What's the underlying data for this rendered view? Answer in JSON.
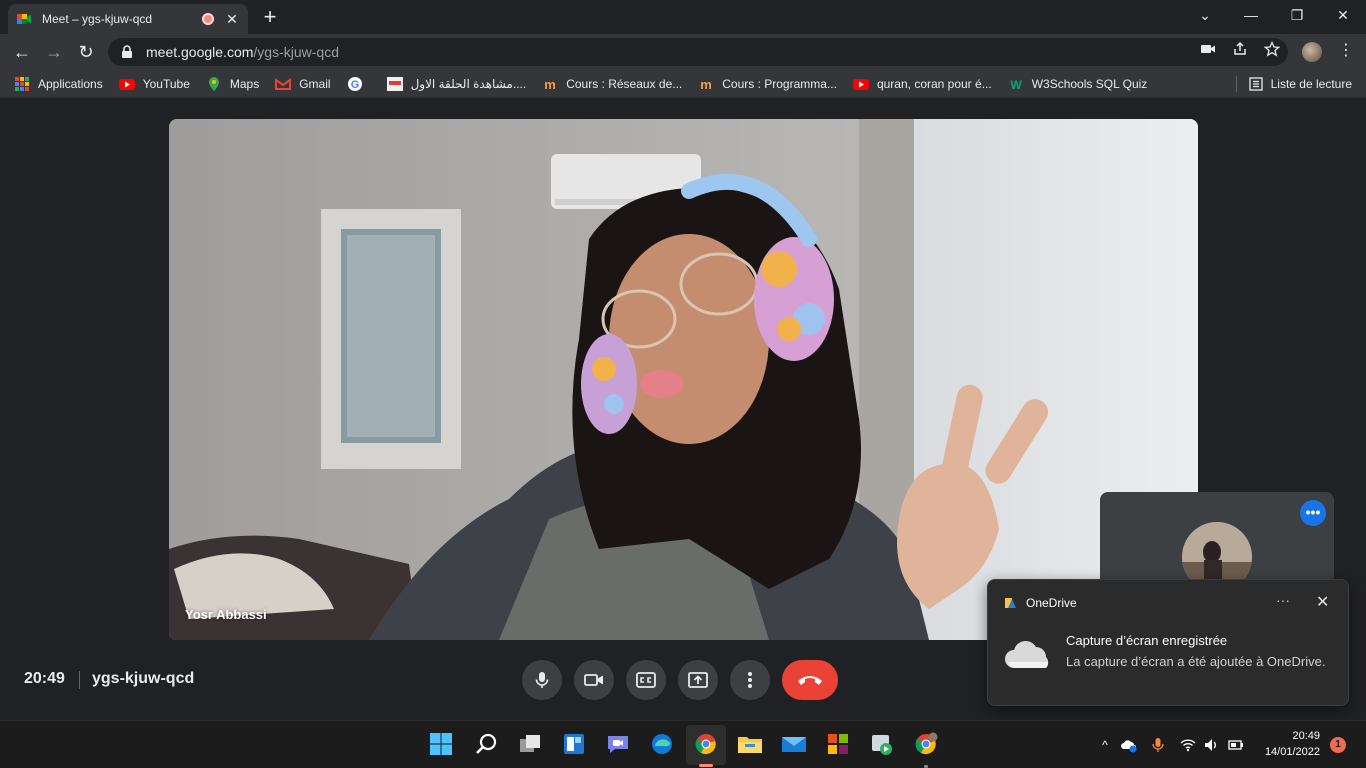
{
  "browser": {
    "tab": {
      "title": "Meet – ygs-kjuw-qcd",
      "close_glyph": "✕"
    },
    "new_tab_glyph": "+",
    "window_controls": {
      "minimize": "—",
      "restore": "❐",
      "close": "✕",
      "tablist": "⌄"
    },
    "nav": {
      "back": "←",
      "forward": "→",
      "reload": "↻"
    },
    "url": {
      "host": "meet.google.com",
      "path": "/ygs-kjuw-qcd"
    },
    "menu_glyph": "⋮",
    "bookmarks": [
      {
        "label": "Applications",
        "icon": "apps-grid-icon"
      },
      {
        "label": "YouTube",
        "icon": "youtube-icon"
      },
      {
        "label": "Maps",
        "icon": "maps-pin-icon"
      },
      {
        "label": "Gmail",
        "icon": "gmail-icon"
      },
      {
        "label": "",
        "icon": "google-icon"
      },
      {
        "label": "مشاهدة الحلقة الاول....",
        "icon": "site-thumb-icon"
      },
      {
        "label": "Cours : Réseaux de...",
        "icon": "openclassrooms-icon"
      },
      {
        "label": "Cours : Programma...",
        "icon": "openclassrooms-icon"
      },
      {
        "label": "quran, coran pour é...",
        "icon": "youtube-icon"
      },
      {
        "label": "W3Schools SQL Quiz",
        "icon": "w3schools-icon"
      }
    ],
    "reading_list": "Liste de lecture"
  },
  "meet": {
    "participant_name": "Yosr Abbassi",
    "time": "20:49",
    "meeting_code": "ygs-kjuw-qcd",
    "self_tile_menu": "•••",
    "controls": [
      {
        "name": "microphone-button",
        "icon": "mic-icon"
      },
      {
        "name": "camera-button",
        "icon": "camera-icon"
      },
      {
        "name": "captions-button",
        "icon": "cc-icon"
      },
      {
        "name": "present-button",
        "icon": "present-icon"
      },
      {
        "name": "more-options-button",
        "icon": "more-vert-icon"
      },
      {
        "name": "end-call-button",
        "icon": "hangup-icon"
      }
    ],
    "colors": {
      "background": "#202124",
      "end_call": "#ea4335",
      "control": "#3c4043",
      "accent": "#1a73e8"
    }
  },
  "notification": {
    "app": "OneDrive",
    "more_glyph": "···",
    "close_glyph": "✕",
    "title": "Capture d’écran enregistrée",
    "body": "La capture d’écran a été ajoutée à OneDrive."
  },
  "taskbar": {
    "apps": [
      "start-icon",
      "search-icon",
      "task-view-icon",
      "widgets-icon",
      "teams-chat-icon",
      "edge-icon",
      "chrome-icon",
      "file-explorer-icon",
      "mail-icon",
      "office-icon",
      "media-player-icon",
      "chrome-profile-icon"
    ],
    "clock_time": "20:49",
    "clock_date": "14/01/2022",
    "notification_count": "1",
    "tray_chevron": "^"
  }
}
